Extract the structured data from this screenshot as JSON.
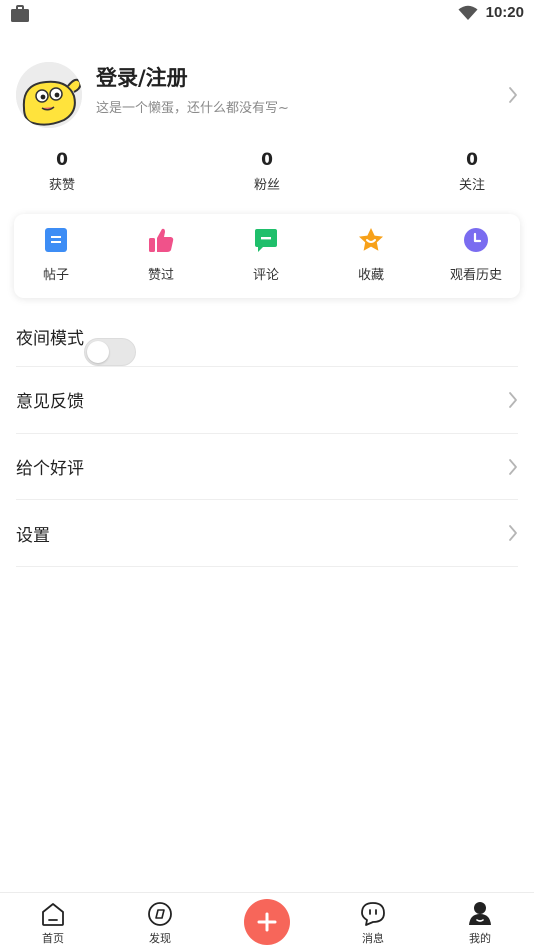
{
  "status_bar": {
    "time": "10:20",
    "icons": [
      "briefcase-icon",
      "wifi-icon"
    ]
  },
  "profile": {
    "name": "登录/注册",
    "subtitle": "这是一个懒蛋，还什么都没有写~"
  },
  "stats": [
    {
      "value": "0",
      "label": "获赞"
    },
    {
      "value": "0",
      "label": "粉丝"
    },
    {
      "value": "0",
      "label": "关注"
    }
  ],
  "shortcuts": [
    {
      "label": "帖子",
      "icon": "post-icon",
      "color": "#3d8df5"
    },
    {
      "label": "赞过",
      "icon": "thumbs-up-icon",
      "color": "#f0528a"
    },
    {
      "label": "评论",
      "icon": "comment-icon",
      "color": "#1fbf6b"
    },
    {
      "label": "收藏",
      "icon": "star-icon",
      "color": "#f7a11a"
    },
    {
      "label": "观看历史",
      "icon": "clock-icon",
      "color": "#7a6cf0"
    }
  ],
  "settings": [
    {
      "label": "夜间模式",
      "control": "toggle",
      "toggle_on": false
    },
    {
      "label": "意见反馈",
      "control": "chevron"
    },
    {
      "label": "给个好评",
      "control": "chevron"
    },
    {
      "label": "设置",
      "control": "chevron"
    }
  ],
  "bottom_nav": {
    "items": [
      {
        "label": "首页",
        "icon": "home-icon"
      },
      {
        "label": "发现",
        "icon": "compass-icon"
      },
      {
        "label": "",
        "icon": "plus-icon",
        "color": "#f7665a"
      },
      {
        "label": "消息",
        "icon": "message-icon"
      },
      {
        "label": "我的",
        "icon": "profile-icon"
      }
    ]
  }
}
